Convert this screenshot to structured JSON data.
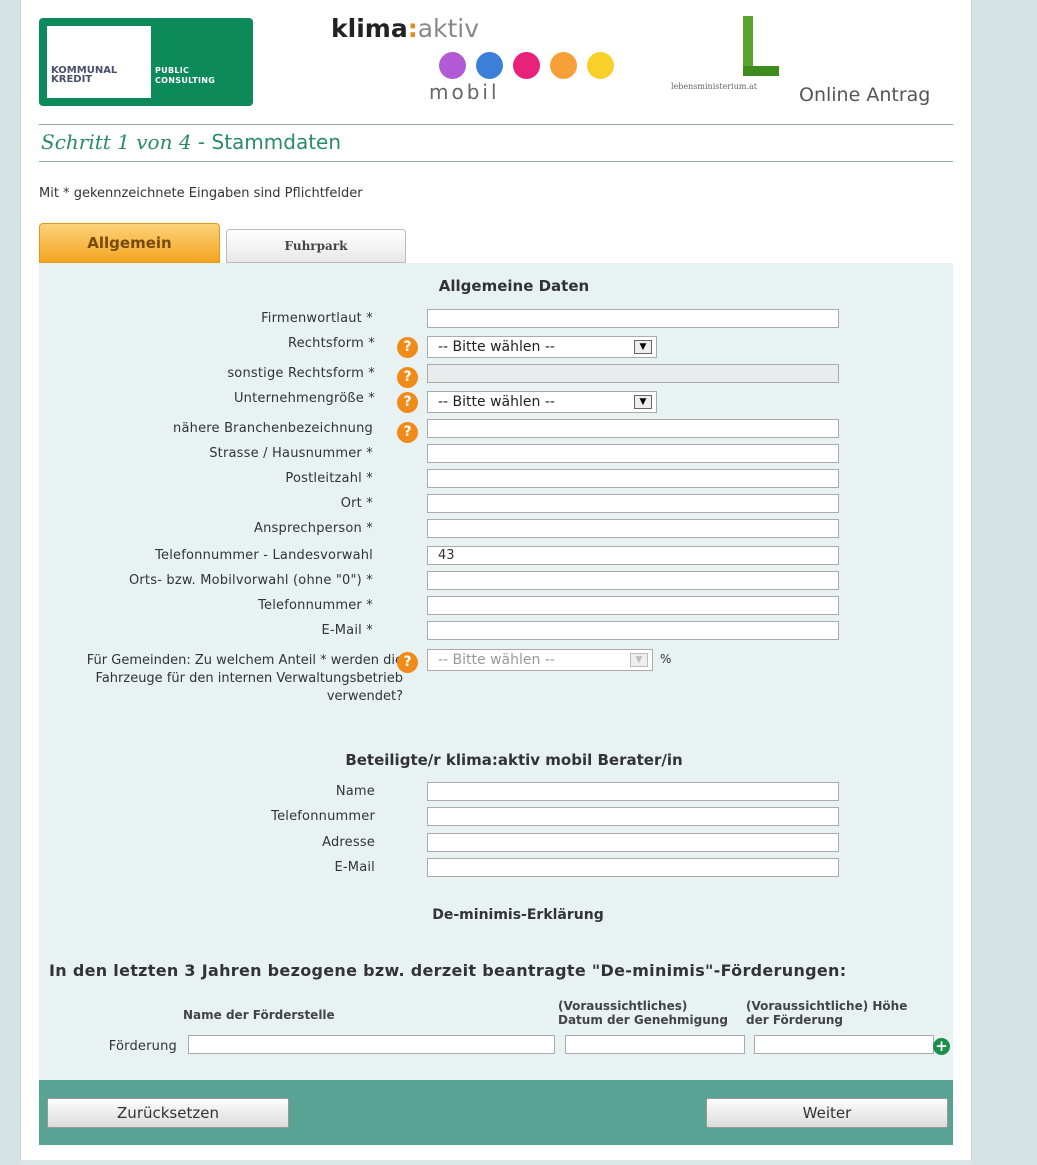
{
  "header": {
    "kk_logo_line1": "KOMMUNAL",
    "kk_logo_line2": "KREDIT",
    "kk_logo_line3": "PUBLIC",
    "kk_logo_line4": "CONSULTING",
    "ka_bold": "klima",
    "ka_colon": ":",
    "ka_thin": "aktiv",
    "ka_mobil": "mobil",
    "lm_text": "lebensministerium.at",
    "online_antrag": "Online Antrag",
    "dot_colors": [
      "#b25ad6",
      "#3c7fd8",
      "#e8217a",
      "#f7a03a",
      "#f9cf2a"
    ]
  },
  "step": {
    "prefix": "Schritt 1 von 4",
    "suffix": " - Stammdaten"
  },
  "required_note": "Mit * gekennzeichnete Eingaben sind Pflichtfelder",
  "tabs": [
    {
      "label": "Allgemein"
    },
    {
      "label": "Fuhrpark"
    }
  ],
  "general": {
    "title": "Allgemeine Daten",
    "firmenwortlaut": "Firmenwortlaut *",
    "rechtsform": "Rechtsform *",
    "sonstige": "sonstige Rechtsform *",
    "groesse": "Unternehmengröße *",
    "branche": "nähere Branchenbezeichnung",
    "strasse": "Strasse / Hausnummer *",
    "plz": "Postleitzahl *",
    "ort": "Ort *",
    "ansprech": "Ansprechperson *",
    "tel_land": "Telefonnummer - Landesvorwahl",
    "tel_land_value": "43",
    "ortsvorwahl": "Orts- bzw. Mobilvorwahl (ohne \"0\") *",
    "telefon": "Telefonnummer *",
    "email": "E-Mail *",
    "gemeinde_q": "Für Gemeinden: Zu welchem Anteil * werden die Fahrzeuge für den internen Verwaltungsbetrieb verwendet?",
    "select_placeholder": "-- Bitte wählen --",
    "percent": "%",
    "help_glyph": "?"
  },
  "berater": {
    "title": "Beteiligte/r klima:aktiv mobil Berater/in",
    "name": "Name",
    "telefon": "Telefonnummer",
    "adresse": "Adresse",
    "email": "E-Mail"
  },
  "deminimis": {
    "title": "De-minimis-Erklärung",
    "heading": "In den letzten 3 Jahren bezogene bzw. derzeit beantragte \"De-minimis\"-Förderungen:",
    "col_name": "Name der Förderstelle",
    "col_date_1": "(Voraussichtliches)",
    "col_date_2": "Datum der Genehmigung",
    "col_amount_1": "(Voraussichtliche) Höhe",
    "col_amount_2": "der Förderung",
    "row_label": "Förderung",
    "add_glyph": "+"
  },
  "footer": {
    "reset": "Zurücksetzen",
    "next": "Weiter"
  }
}
